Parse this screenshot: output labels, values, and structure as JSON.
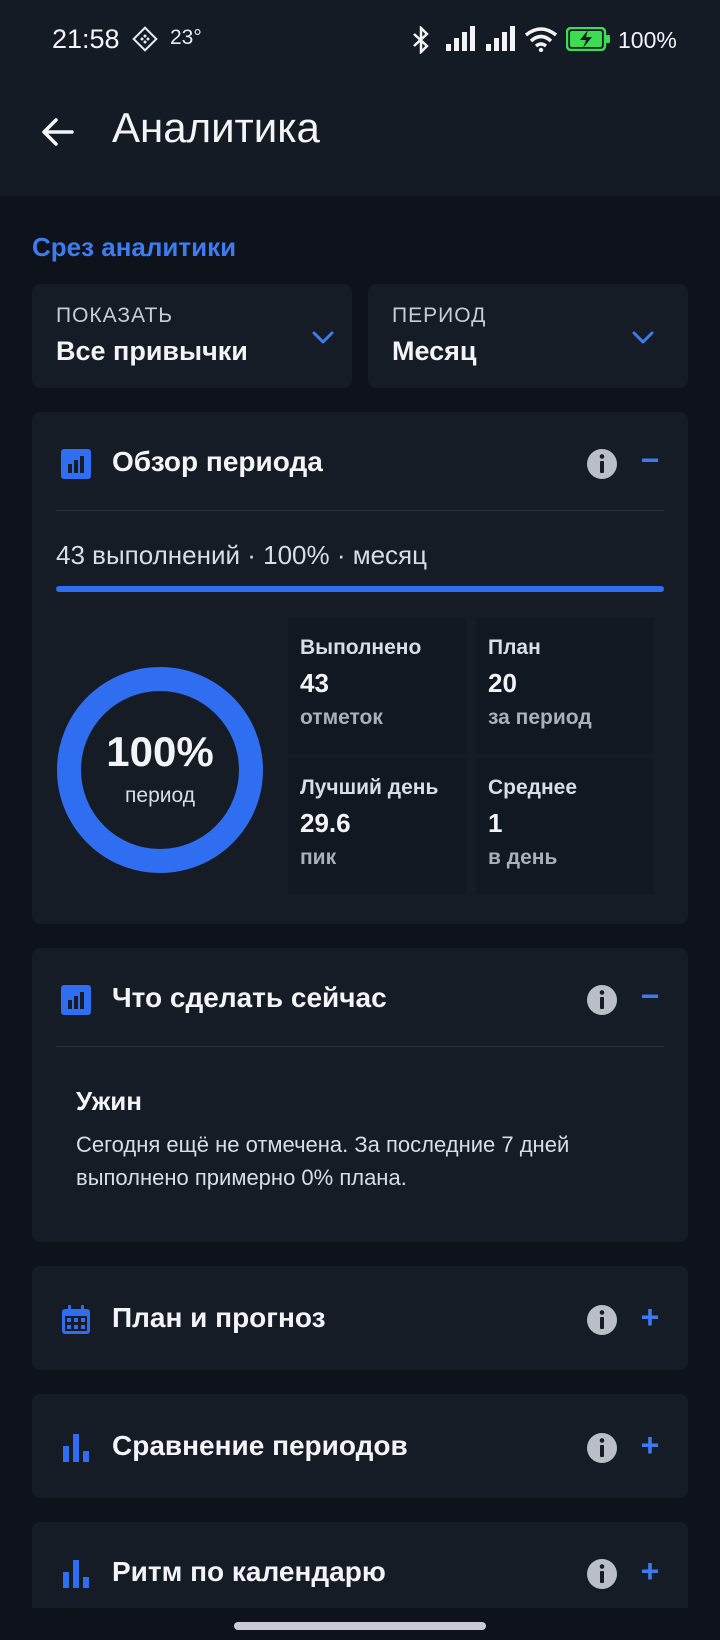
{
  "status_bar": {
    "time": "21:58",
    "temperature": "23°",
    "battery": "100%",
    "icons": [
      "app-notification-icon",
      "bluetooth-icon",
      "signal-icon",
      "signal-icon",
      "wifi-icon",
      "battery-charging-icon"
    ]
  },
  "app_bar": {
    "title": "Аналитика",
    "back_icon": "arrow-back-icon"
  },
  "filters": {
    "section_label": "Срез аналитики",
    "show": {
      "caption": "ПОКАЗАТЬ",
      "value": "Все привычки"
    },
    "period": {
      "caption": "ПЕРИОД",
      "value": "Месяц"
    }
  },
  "overview": {
    "title": "Обзор периода",
    "toggle": "−",
    "summary": "43 выполнений · 100% · месяц",
    "progress_fraction": 1.0,
    "donut": {
      "value": "100%",
      "label": "период",
      "fraction": 1.0
    },
    "stats": [
      {
        "label": "Выполнено",
        "value": "43",
        "unit": "отметок"
      },
      {
        "label": "План",
        "value": "20",
        "unit": "за период"
      },
      {
        "label": "Лучший день",
        "value": "29.6",
        "unit": "пик"
      },
      {
        "label": "Среднее",
        "value": "1",
        "unit": "в день"
      }
    ]
  },
  "now": {
    "title": "Что сделать сейчас",
    "toggle": "−",
    "habit": "Ужин",
    "text": "Сегодня ещё не отмечена. За последние 7 дней выполнено примерно 0% плана."
  },
  "sections": [
    {
      "title": "План и прогноз",
      "icon": "calendar-icon",
      "toggle": "+"
    },
    {
      "title": "Сравнение периодов",
      "icon": "bar-chart-icon",
      "toggle": "+"
    },
    {
      "title": "Ритм по календарю",
      "icon": "bar-chart-icon",
      "toggle": "+"
    }
  ],
  "colors": {
    "accent": "#2f6ef0",
    "accent_text": "#3d7cf0",
    "background": "#0e131b",
    "card": "#161c26"
  }
}
